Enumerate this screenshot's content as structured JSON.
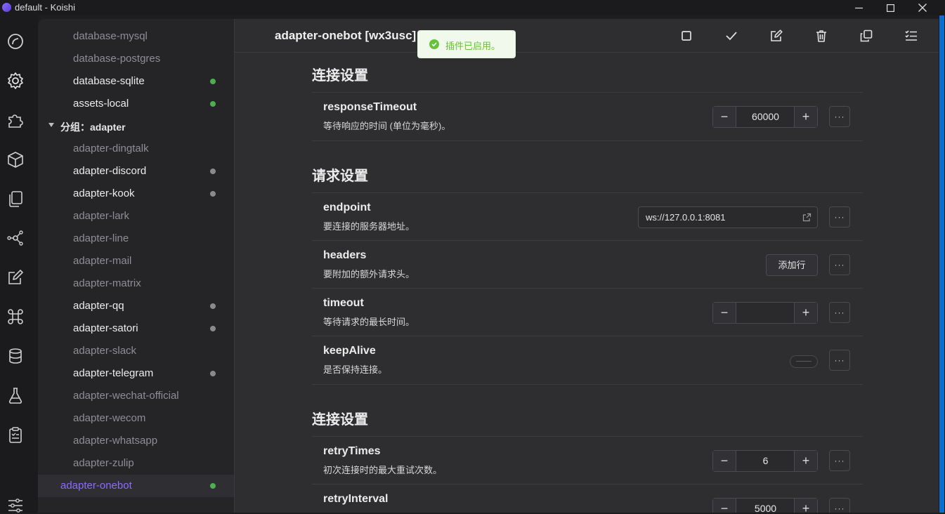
{
  "window": {
    "title": "default - Koishi"
  },
  "activity": [
    "dashboard-icon",
    "settings-icon",
    "plugin-icon",
    "market-icon",
    "files-icon",
    "graph-icon",
    "editor-icon",
    "command-icon",
    "database-icon",
    "sandbox-icon",
    "logs-icon",
    "config-icon"
  ],
  "sidebar": {
    "items": [
      {
        "label": "database-mysql",
        "enabled": false,
        "dot": ""
      },
      {
        "label": "database-postgres",
        "enabled": false,
        "dot": ""
      },
      {
        "label": "database-sqlite",
        "enabled": true,
        "dot": "#4caf50"
      },
      {
        "label": "assets-local",
        "enabled": true,
        "dot": "#4caf50"
      },
      {
        "label": "分组：adapter",
        "group": true
      },
      {
        "label": "adapter-dingtalk",
        "enabled": false,
        "dot": ""
      },
      {
        "label": "adapter-discord",
        "enabled": true,
        "dot": "#8a8a8a"
      },
      {
        "label": "adapter-kook",
        "enabled": true,
        "dot": "#8a8a8a"
      },
      {
        "label": "adapter-lark",
        "enabled": false,
        "dot": ""
      },
      {
        "label": "adapter-line",
        "enabled": false,
        "dot": ""
      },
      {
        "label": "adapter-mail",
        "enabled": false,
        "dot": ""
      },
      {
        "label": "adapter-matrix",
        "enabled": false,
        "dot": ""
      },
      {
        "label": "adapter-qq",
        "enabled": true,
        "dot": "#8a8a8a"
      },
      {
        "label": "adapter-satori",
        "enabled": true,
        "dot": "#8a8a8a"
      },
      {
        "label": "adapter-slack",
        "enabled": false,
        "dot": ""
      },
      {
        "label": "adapter-telegram",
        "enabled": true,
        "dot": "#8a8a8a"
      },
      {
        "label": "adapter-wechat-official",
        "enabled": false,
        "dot": ""
      },
      {
        "label": "adapter-wecom",
        "enabled": false,
        "dot": ""
      },
      {
        "label": "adapter-whatsapp",
        "enabled": false,
        "dot": ""
      },
      {
        "label": "adapter-zulip",
        "enabled": false,
        "dot": ""
      },
      {
        "label": "adapter-onebot",
        "active": true,
        "dot": "#4caf50"
      }
    ]
  },
  "header": {
    "title": "adapter-onebot [wx3usc]",
    "toolbar": [
      "stop-icon",
      "check-icon",
      "edit-icon",
      "trash-icon",
      "copy-icon",
      "checklist-icon"
    ]
  },
  "toast": {
    "message": "插件已启用。"
  },
  "sections": {
    "s1": {
      "title": "连接设置"
    },
    "s2": {
      "title": "请求设置"
    },
    "s3": {
      "title": "连接设置"
    }
  },
  "fields": {
    "responseTimeout": {
      "name": "responseTimeout",
      "desc": "等待响应的时间 (单位为毫秒)。",
      "value": "60000"
    },
    "endpoint": {
      "name": "endpoint",
      "desc": "要连接的服务器地址。",
      "value": "ws://127.0.0.1:8081"
    },
    "headers": {
      "name": "headers",
      "desc": "要附加的额外请求头。",
      "button": "添加行"
    },
    "timeout": {
      "name": "timeout",
      "desc": "等待请求的最长时间。",
      "value": ""
    },
    "keepAlive": {
      "name": "keepAlive",
      "desc": "是否保持连接。",
      "value": false
    },
    "retryTimes": {
      "name": "retryTimes",
      "desc": "初次连接时的最大重试次数。",
      "value": "6"
    },
    "retryInterval": {
      "name": "retryInterval",
      "value": "5000"
    }
  },
  "colors": {
    "accent": "#8d6bff",
    "success": "#67c23a",
    "scrollbar": "#0b6fcf"
  }
}
